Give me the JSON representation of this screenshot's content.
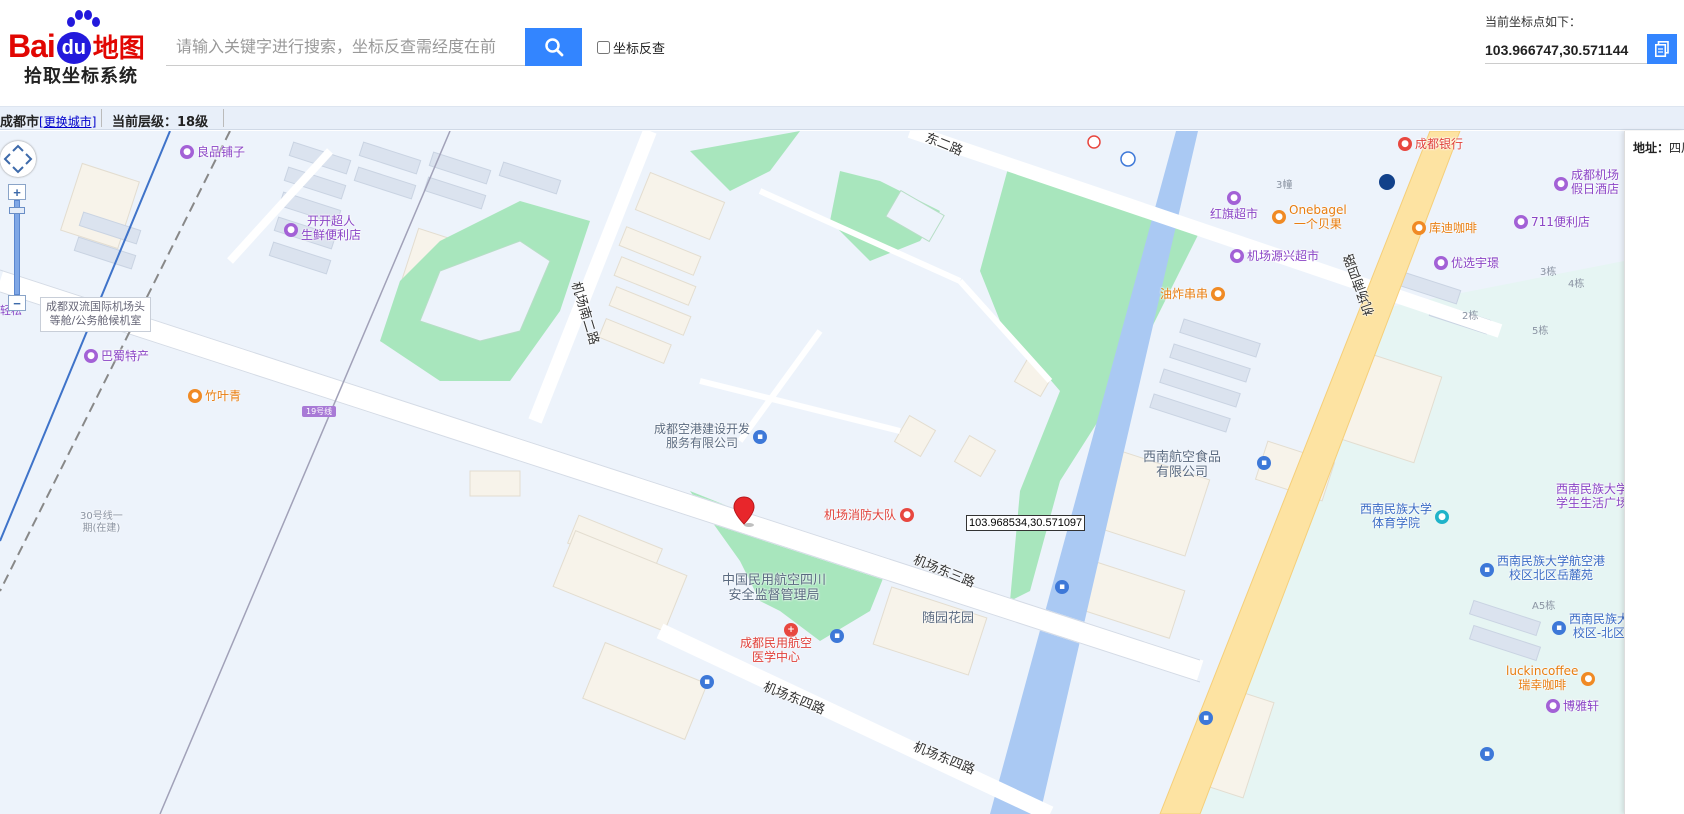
{
  "header": {
    "logo_bai": "Bai",
    "logo_du": "du",
    "logo_ditu": "地图",
    "subtitle": "拾取坐标系统",
    "search_placeholder": "请输入关键字进行搜索，坐标反查需经度在前",
    "reverse_label": "坐标反查",
    "coord_label": "当前坐标点如下：",
    "coord_value": "103.966747,30.571144"
  },
  "status": {
    "city": "成都市",
    "change_city": "[更换城市]",
    "level": "当前层级：18级"
  },
  "map": {
    "tooltip": "103.968534,30.571097",
    "pois": [
      {
        "name": "良品铺子",
        "color": "purple"
      },
      {
        "name": "开开超人",
        "name2": "生鲜便利店",
        "color": "purple"
      },
      {
        "name": "巴蜀特产",
        "color": "purple"
      },
      {
        "name": "竹叶青",
        "color": "orange"
      },
      {
        "name": "成都空港建设开发",
        "name2": "服务有限公司",
        "color": "blue"
      },
      {
        "name": "机场消防大队",
        "color": "red"
      },
      {
        "name": "成都民用航空",
        "name2": "医学中心",
        "color": "red"
      },
      {
        "name": "红旗超市",
        "color": "purple"
      },
      {
        "name": "Onebagel",
        "name2": "一个贝果",
        "color": "orange"
      },
      {
        "name": "机场源兴超市",
        "color": "purple"
      },
      {
        "name": "油炸串串",
        "color": "orange"
      },
      {
        "name": "成都银行",
        "color": "red"
      },
      {
        "name": "库迪咖啡",
        "color": "orange"
      },
      {
        "name": "711便利店",
        "color": "purple"
      },
      {
        "name": "成都机场",
        "name2": "假日酒店",
        "color": "purple"
      },
      {
        "name": "优选宇璟",
        "color": "purple"
      },
      {
        "name": "西南民族大学",
        "name2": "体育学院",
        "color": "teal"
      },
      {
        "name": "西南民族大学航空港",
        "name2": "校区北区岳麓苑",
        "color": "blue"
      },
      {
        "name": "西南民族大学",
        "name2": "学生生活广场",
        "color": "purple"
      },
      {
        "name": "西南民族大",
        "name2": "校区-北区",
        "color": "blue"
      },
      {
        "name": "luckincoffee",
        "name2": "瑞幸咖啡",
        "color": "orange"
      },
      {
        "name": "博雅轩",
        "color": "purple"
      }
    ],
    "areas": [
      {
        "name": "中国民用航空四川",
        "name2": "安全监督管理局"
      },
      {
        "name": "西南航空食品",
        "name2": "有限公司"
      },
      {
        "name": "随园花园"
      }
    ],
    "roads": [
      "机场南二路",
      "机场东三路",
      "机场东四路",
      "机场南四路",
      "机场东四路",
      "东二路"
    ],
    "box_label": {
      "line1": "成都双流国际机场头",
      "line2": "等舱/公务舱候机室"
    },
    "metro_tag": "19号线",
    "line30": {
      "line1": "30号线一",
      "line2": "期(在建)"
    },
    "edge_text": "轻松",
    "buildings": [
      "3幢",
      "3栋",
      "4栋",
      "2栋",
      "5栋",
      "A5栋"
    ]
  },
  "side": {
    "addr_label": "地址：",
    "addr_value": "四川"
  }
}
